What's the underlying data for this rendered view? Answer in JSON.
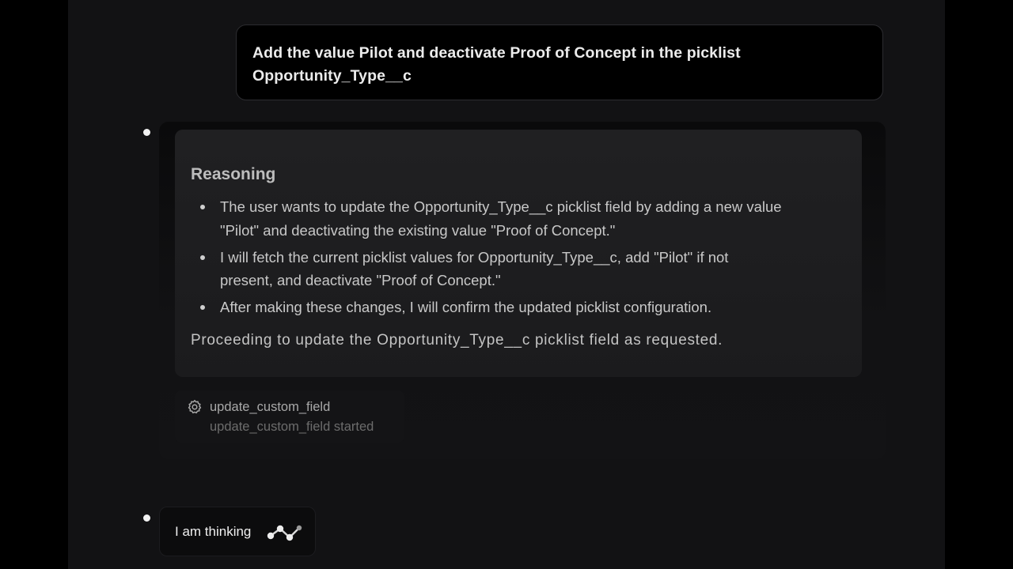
{
  "user_message": {
    "line1": "Add the value Pilot and deactivate Proof of Concept in the picklist",
    "line2": "Opportunity_Type__c"
  },
  "reasoning": {
    "title": "Reasoning",
    "items": [
      {
        "line1": "The user wants to update the Opportunity_Type__c picklist field by adding a new value",
        "line2": "\"Pilot\" and deactivating the existing value \"Proof of Concept.\""
      },
      {
        "line1": "I will fetch the current picklist values for Opportunity_Type__c, add \"Pilot\" if not",
        "line2": "present, and deactivate \"Proof of Concept.\""
      },
      {
        "line1": "After making these changes, I will confirm the updated picklist configuration."
      }
    ],
    "summary": "Proceeding to update the Opportunity_Type__c picklist field as requested."
  },
  "tool_call": {
    "icon": "gear-icon",
    "name": "update_custom_field",
    "status": "update_custom_field started"
  },
  "thinking": {
    "label": "I am thinking",
    "icon": "thinking-dots-icon"
  },
  "colors": {
    "page_background": "#000000",
    "chat_background": "#121214",
    "user_bubble_background": "#000000",
    "reasoning_card_background": "#1f1f21",
    "primary_text": "#ececec",
    "muted_text": "#6c6c6c"
  }
}
